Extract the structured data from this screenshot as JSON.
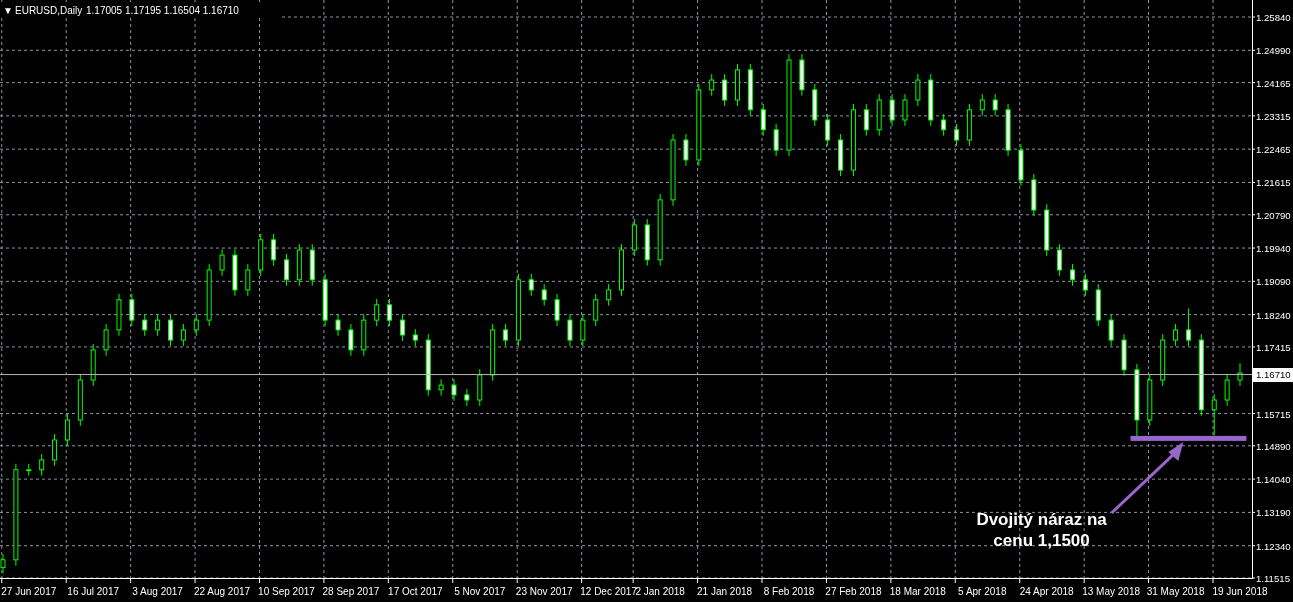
{
  "header": {
    "menu_arrow": "▼",
    "title": "EURUSD,Daily",
    "ohlc": "1.17005 1.17195 1.16504 1.16710"
  },
  "chart": {
    "chart_data": {
      "type": "candlestick",
      "grid": true,
      "ylim": [
        1.11515,
        1.2584
      ],
      "categories": [
        null,
        null,
        "27 Jun 2017",
        null,
        null,
        null,
        null,
        "16 Jul 2017",
        null,
        null,
        null,
        null,
        "3 Aug 2017",
        null,
        null,
        null,
        null,
        "22 Aug 2017",
        null,
        null,
        null,
        null,
        "10 Sep 2017",
        null,
        null,
        null,
        null,
        "28 Sep 2017",
        null,
        null,
        null,
        null,
        "17 Oct 2017",
        null,
        null,
        null,
        null,
        "5 Nov 2017",
        null,
        null,
        null,
        null,
        "23 Nov 2017",
        null,
        null,
        null,
        null,
        "12 Dec 2017",
        null,
        null,
        null,
        "2 Jan 2018",
        null,
        null,
        null,
        null,
        "21 Jan 2018",
        null,
        null,
        null,
        null,
        "8 Feb 2018",
        null,
        null,
        null,
        null,
        "27 Feb 2018",
        null,
        null,
        null,
        null,
        "18 Mar 2018",
        null,
        null,
        null,
        null,
        "5 Apr 2018",
        null,
        null,
        null,
        null,
        "24 Apr 2018",
        null,
        null,
        null,
        null,
        "13 May 2018",
        null,
        null,
        null,
        null,
        "31 May 2018",
        null,
        null,
        null,
        null,
        "19 Jun 2018"
      ],
      "ohlc": [
        [
          1.1178,
          1.1213,
          1.1163,
          1.1198
        ],
        [
          1.1198,
          1.1443,
          1.1183,
          1.1428
        ],
        [
          1.1428,
          1.1443,
          1.1413,
          1.1428
        ],
        [
          1.1428,
          1.1468,
          1.1413,
          1.1453
        ],
        [
          1.1453,
          1.1519,
          1.1438,
          1.1504
        ],
        [
          1.1504,
          1.157,
          1.1489,
          1.1555
        ],
        [
          1.1555,
          1.1672,
          1.154,
          1.1657
        ],
        [
          1.1657,
          1.1749,
          1.1642,
          1.1734
        ],
        [
          1.1734,
          1.18,
          1.1719,
          1.1785
        ],
        [
          1.1785,
          1.1877,
          1.177,
          1.1862
        ],
        [
          1.1862,
          1.1877,
          1.1795,
          1.181
        ],
        [
          1.181,
          1.1825,
          1.177,
          1.1785
        ],
        [
          1.1785,
          1.1825,
          1.177,
          1.181
        ],
        [
          1.181,
          1.1825,
          1.1744,
          1.1759
        ],
        [
          1.1759,
          1.18,
          1.1744,
          1.1785
        ],
        [
          1.1785,
          1.1825,
          1.177,
          1.181
        ],
        [
          1.181,
          1.1953,
          1.1795,
          1.1938
        ],
        [
          1.1938,
          1.1991,
          1.1923,
          1.1976
        ],
        [
          1.1976,
          1.1991,
          1.1872,
          1.1887
        ],
        [
          1.1887,
          1.1953,
          1.1872,
          1.1938
        ],
        [
          1.1938,
          1.203,
          1.1923,
          1.2015
        ],
        [
          1.2015,
          1.203,
          1.1949,
          1.1964
        ],
        [
          1.1964,
          1.1979,
          1.1898,
          1.1913
        ],
        [
          1.1913,
          1.2004,
          1.1898,
          1.1989
        ],
        [
          1.1989,
          1.2004,
          1.1898,
          1.1913
        ],
        [
          1.1913,
          1.1928,
          1.1795,
          1.181
        ],
        [
          1.181,
          1.1825,
          1.177,
          1.1785
        ],
        [
          1.1785,
          1.18,
          1.1719,
          1.1734
        ],
        [
          1.1734,
          1.1825,
          1.1719,
          1.181
        ],
        [
          1.181,
          1.1864,
          1.1795,
          1.1849
        ],
        [
          1.1849,
          1.1864,
          1.1795,
          1.181
        ],
        [
          1.181,
          1.1825,
          1.1757,
          1.1772
        ],
        [
          1.1772,
          1.1787,
          1.1744,
          1.1759
        ],
        [
          1.1759,
          1.1774,
          1.1617,
          1.1632
        ],
        [
          1.1632,
          1.1659,
          1.1617,
          1.1644
        ],
        [
          1.1644,
          1.1659,
          1.1604,
          1.1619
        ],
        [
          1.1619,
          1.1634,
          1.1591,
          1.1606
        ],
        [
          1.1606,
          1.1685,
          1.1591,
          1.167
        ],
        [
          1.167,
          1.18,
          1.1655,
          1.1785
        ],
        [
          1.1785,
          1.18,
          1.1744,
          1.1759
        ],
        [
          1.1759,
          1.1928,
          1.1744,
          1.1913
        ],
        [
          1.1913,
          1.1928,
          1.1872,
          1.1887
        ],
        [
          1.1887,
          1.1902,
          1.1847,
          1.1862
        ],
        [
          1.1862,
          1.1877,
          1.1795,
          1.181
        ],
        [
          1.181,
          1.1825,
          1.1744,
          1.1759
        ],
        [
          1.1759,
          1.1825,
          1.1744,
          1.181
        ],
        [
          1.181,
          1.1877,
          1.1795,
          1.1862
        ],
        [
          1.1862,
          1.1902,
          1.1847,
          1.1887
        ],
        [
          1.1887,
          1.2004,
          1.1872,
          1.1989
        ],
        [
          1.1989,
          1.2068,
          1.1974,
          1.2053
        ],
        [
          1.2053,
          1.2068,
          1.1949,
          1.1964
        ],
        [
          1.1964,
          1.2132,
          1.1949,
          1.2117
        ],
        [
          1.2117,
          1.2285,
          1.2102,
          1.227
        ],
        [
          1.227,
          1.2285,
          1.2204,
          1.2219
        ],
        [
          1.2219,
          1.2413,
          1.2204,
          1.2398
        ],
        [
          1.2398,
          1.2438,
          1.2383,
          1.2423
        ],
        [
          1.2423,
          1.2438,
          1.2357,
          1.2372
        ],
        [
          1.2372,
          1.2464,
          1.2357,
          1.2449
        ],
        [
          1.2449,
          1.2464,
          1.2332,
          1.2347
        ],
        [
          1.2347,
          1.2362,
          1.2281,
          1.2296
        ],
        [
          1.2296,
          1.2311,
          1.2229,
          1.2244
        ],
        [
          1.2244,
          1.2489,
          1.2229,
          1.2474
        ],
        [
          1.2474,
          1.2489,
          1.2383,
          1.2398
        ],
        [
          1.2398,
          1.2413,
          1.2306,
          1.2321
        ],
        [
          1.2321,
          1.2336,
          1.2255,
          1.227
        ],
        [
          1.227,
          1.2285,
          1.2178,
          1.2193
        ],
        [
          1.2193,
          1.2362,
          1.2178,
          1.2347
        ],
        [
          1.2347,
          1.2362,
          1.2281,
          1.2296
        ],
        [
          1.2296,
          1.2387,
          1.2281,
          1.2372
        ],
        [
          1.2372,
          1.2387,
          1.2306,
          1.2321
        ],
        [
          1.2321,
          1.2387,
          1.2306,
          1.2372
        ],
        [
          1.2372,
          1.2438,
          1.2357,
          1.2423
        ],
        [
          1.2423,
          1.2438,
          1.2306,
          1.2321
        ],
        [
          1.2321,
          1.2336,
          1.2281,
          1.2296
        ],
        [
          1.2296,
          1.2311,
          1.2255,
          1.227
        ],
        [
          1.227,
          1.2362,
          1.2255,
          1.2347
        ],
        [
          1.2347,
          1.2387,
          1.2332,
          1.2372
        ],
        [
          1.2372,
          1.2387,
          1.2332,
          1.2347
        ],
        [
          1.2347,
          1.2362,
          1.2229,
          1.2244
        ],
        [
          1.2244,
          1.2259,
          1.2153,
          1.2168
        ],
        [
          1.2168,
          1.2183,
          1.2076,
          1.2091
        ],
        [
          1.2091,
          1.2106,
          1.1974,
          1.1989
        ],
        [
          1.1989,
          1.2004,
          1.1923,
          1.1938
        ],
        [
          1.1938,
          1.1953,
          1.1898,
          1.1913
        ],
        [
          1.1913,
          1.1928,
          1.1872,
          1.1887
        ],
        [
          1.1887,
          1.1902,
          1.1795,
          1.181
        ],
        [
          1.181,
          1.1825,
          1.1744,
          1.1759
        ],
        [
          1.1759,
          1.1774,
          1.1668,
          1.1683
        ],
        [
          1.1683,
          1.1698,
          1.151,
          1.1555
        ],
        [
          1.1555,
          1.1672,
          1.154,
          1.1657
        ],
        [
          1.1657,
          1.1774,
          1.1642,
          1.1759
        ],
        [
          1.1759,
          1.18,
          1.1744,
          1.1785
        ],
        [
          1.1785,
          1.184,
          1.1744,
          1.1759
        ],
        [
          1.1759,
          1.1774,
          1.1566,
          1.1581
        ],
        [
          1.1581,
          1.1621,
          1.1515,
          1.1606
        ],
        [
          1.1606,
          1.1672,
          1.1591,
          1.1657
        ],
        [
          1.1657,
          1.17,
          1.1642,
          1.1675
        ]
      ],
      "yticks": [
        {
          "value": 1.2584,
          "label": "1.25840"
        },
        {
          "value": 1.2499,
          "label": "1.24990"
        },
        {
          "value": 1.24165,
          "label": "1.24165"
        },
        {
          "value": 1.23315,
          "label": "1.23315"
        },
        {
          "value": 1.22465,
          "label": "1.22465"
        },
        {
          "value": 1.21615,
          "label": "1.21615"
        },
        {
          "value": 1.2079,
          "label": "1.20790"
        },
        {
          "value": 1.1994,
          "label": "1.19940"
        },
        {
          "value": 1.1909,
          "label": "1.19090"
        },
        {
          "value": 1.1824,
          "label": "1.18240"
        },
        {
          "value": 1.17415,
          "label": "1.17415"
        },
        {
          "value": 1.15715,
          "label": "1.15715"
        },
        {
          "value": 1.1489,
          "label": "1.14890"
        },
        {
          "value": 1.1404,
          "label": "1.14040"
        },
        {
          "value": 1.1319,
          "label": "1.13190"
        },
        {
          "value": 1.1234,
          "label": "1.12340"
        },
        {
          "value": 1.11515,
          "label": "1.11515"
        }
      ],
      "ref_lines": [
        {
          "axis": "y",
          "value": 1.1671,
          "label": "1.16710",
          "color": "#b8b8b8"
        }
      ],
      "annotations": [
        "Dvojitý náraz na\ncenu 1,1500"
      ]
    }
  }
}
